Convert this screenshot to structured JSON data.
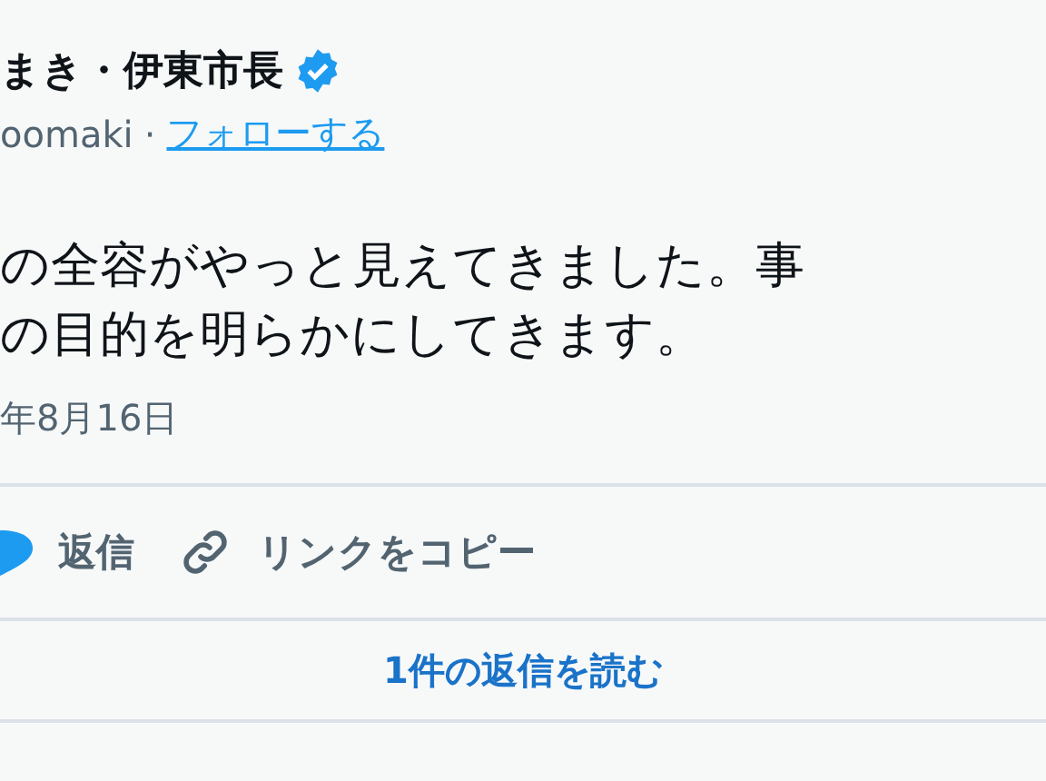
{
  "author": {
    "name": "まき・伊東市長",
    "verified": true,
    "handle": "oomaki",
    "separator": "·",
    "follow": "フォローする"
  },
  "body": [
    "の全容がやっと見えてきました。事",
    "の目的を明らかにしてきます。"
  ],
  "date": "年8月16日",
  "actions": [
    {
      "kind": "reply",
      "label": "返信"
    },
    {
      "kind": "copy-link",
      "label": "リンクをコピー"
    }
  ],
  "read_replies": "1件の返信を読む"
}
